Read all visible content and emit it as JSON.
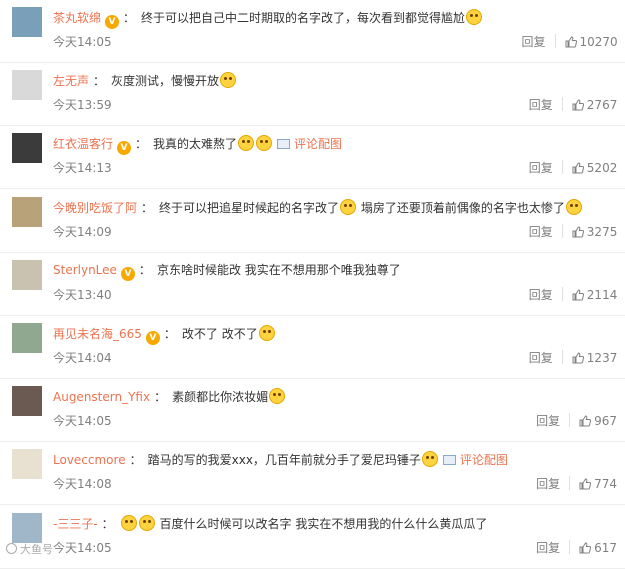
{
  "labels": {
    "reply": "回复",
    "pic_link": "评论配图",
    "watermark": "大鱼号"
  },
  "colors": {
    "username": "#eb7350",
    "meta": "#808080",
    "badge": "#f7a900"
  },
  "comments": [
    {
      "user": "茶丸软绵",
      "badge": true,
      "text": "终于可以把自己中二时期取的名字改了，每次看到都觉得尴尬",
      "emoji_after": 1,
      "text2": "",
      "emoji_end": 0,
      "pic": false,
      "time": "今天14:05",
      "likes": "10270"
    },
    {
      "user": "左无声",
      "badge": false,
      "text": "灰度测试，慢慢开放",
      "emoji_after": 1,
      "text2": "",
      "emoji_end": 0,
      "pic": false,
      "time": "今天13:59",
      "likes": "2767"
    },
    {
      "user": "红衣温客行",
      "badge": true,
      "text": "我真的太难熬了",
      "emoji_after": 2,
      "text2": "",
      "emoji_end": 0,
      "pic": true,
      "time": "今天14:13",
      "likes": "5202"
    },
    {
      "user": "今晚别吃饭了阿",
      "badge": false,
      "text": "终于可以把追星时候起的名字改了",
      "emoji_after": 1,
      "text2": "塌房了还要顶着前偶像的名字也太惨了",
      "emoji_end": 1,
      "pic": false,
      "time": "今天14:09",
      "likes": "3275"
    },
    {
      "user": "SterlynLee",
      "badge": true,
      "text": "京东啥时候能改 我实在不想用那个唯我独尊了",
      "emoji_after": 0,
      "text2": "",
      "emoji_end": 0,
      "pic": false,
      "time": "今天13:40",
      "likes": "2114"
    },
    {
      "user": "再见未名海_665",
      "badge": true,
      "text": "改不了 改不了",
      "emoji_after": 1,
      "text2": "",
      "emoji_end": 0,
      "pic": false,
      "time": "今天14:04",
      "likes": "1237"
    },
    {
      "user": "Augenstern_Yfix",
      "badge": false,
      "text": "素颜都比你浓妆媚",
      "emoji_after": 1,
      "text2": "",
      "emoji_end": 0,
      "pic": false,
      "time": "今天14:05",
      "likes": "967"
    },
    {
      "user": "Loveccmore",
      "badge": false,
      "text": "踏马的写的我爱xxx，几百年前就分手了爱尼玛锤子",
      "emoji_after": 1,
      "text2": "",
      "emoji_end": 0,
      "pic": true,
      "time": "今天14:08",
      "likes": "774"
    },
    {
      "user": "-三三子-",
      "badge": false,
      "text": "",
      "emoji_after": 0,
      "text2": "百度什么时候可以改名字 我实在不想用我的什么什么黄瓜瓜了",
      "emoji_end": 0,
      "emoji_before": 2,
      "pic": false,
      "time": "今天14:05",
      "likes": "617"
    }
  ]
}
